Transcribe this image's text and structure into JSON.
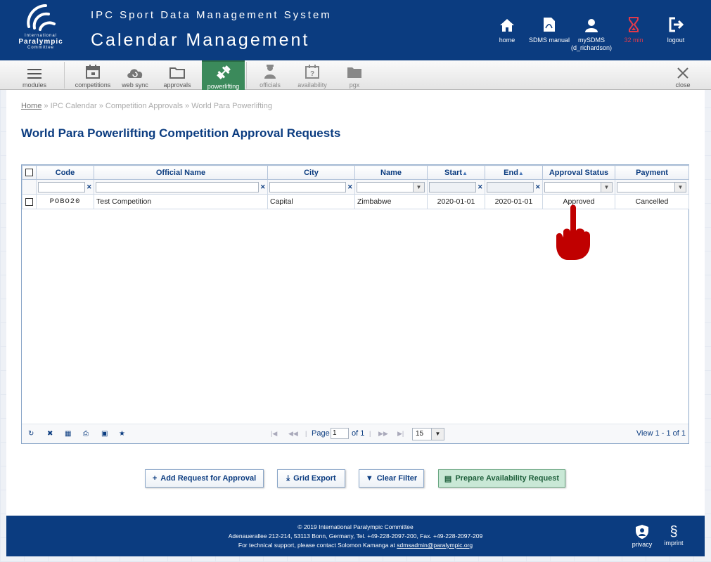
{
  "header": {
    "logo": {
      "line1": "International",
      "line2": "Paralympic",
      "line3": "Committee"
    },
    "system_title": "IPC Sport Data Management System",
    "page_title": "Calendar Management",
    "nav": [
      {
        "label": "home",
        "icon": "home-icon"
      },
      {
        "label": "SDMS manual",
        "icon": "pdf-icon"
      },
      {
        "label": "mySDMS\n(d_richardson)",
        "icon": "user-icon"
      },
      {
        "label": "32 min",
        "icon": "hourglass-icon",
        "color": "#e23a4a"
      },
      {
        "label": "logout",
        "icon": "logout-icon"
      }
    ]
  },
  "toolbar": {
    "modules": "modules",
    "competitions": "competitions",
    "web_sync": "web sync",
    "approvals": "approvals",
    "powerlifting": "powerlifting",
    "officials": "officials",
    "availability": "availability",
    "pgx": "pgx",
    "close": "close"
  },
  "breadcrumb": {
    "home": "Home",
    "sep": "»",
    "items": [
      "IPC Calendar",
      "Competition Approvals",
      "World Para Powerlifting"
    ]
  },
  "heading": "World Para Powerlifting Competition Approval Requests",
  "grid": {
    "columns": [
      "Code",
      "Official Name",
      "City",
      "Name",
      "Start",
      "End",
      "Approval Status",
      "Payment"
    ],
    "rows": [
      {
        "code": "POBO20",
        "official_name": "Test Competition",
        "city": "Capital",
        "name": "Zimbabwe",
        "start": "2020-01-01",
        "end": "2020-01-01",
        "approval_status": "Approved",
        "payment": "Cancelled"
      }
    ],
    "pager": {
      "page_label": "Page",
      "page_value": "1",
      "of_label": "of 1",
      "page_size": "15",
      "view_info": "View 1 - 1 of 1"
    }
  },
  "buttons": {
    "add_request": "Add Request for Approval",
    "grid_export": "Grid Export",
    "clear_filter": "Clear Filter",
    "prepare_availability": "Prepare Availability Request"
  },
  "footer": {
    "copyright": "© 2019 International Paralympic Committee",
    "address": "Adenauerallee 212-214, 53113 Bonn, Germany, Tel. +49-228-2097-200, Fax. +49-228-2097-209",
    "support_prefix": "For technical support, please contact Solomon Kamanga at",
    "support_email": "sdmsadmin@paralympic.org",
    "privacy": "privacy",
    "imprint": "imprint",
    "imprint_symbol": "§"
  },
  "colors": {
    "brand": "#0b3c80",
    "active_tab": "#3b8a5b",
    "timer": "#e23a4a",
    "pointer": "#c00000"
  }
}
